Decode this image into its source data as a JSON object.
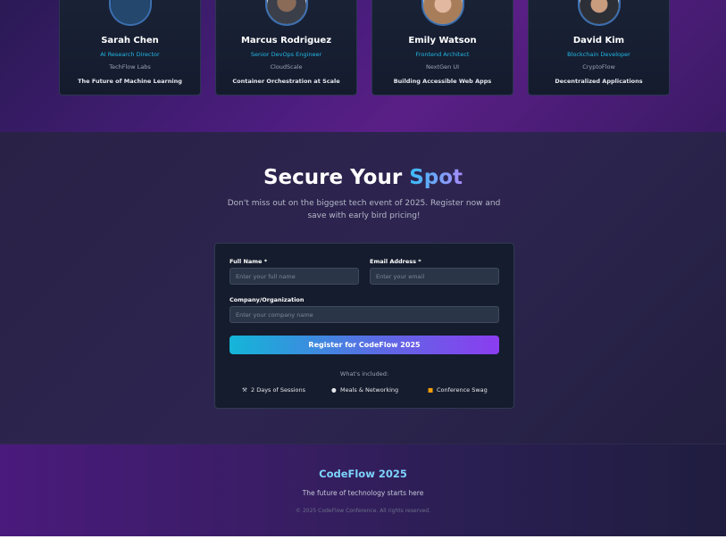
{
  "speakers": [
    {
      "name": "Sarah Chen",
      "role": "AI Research Director",
      "company": "TechFlow Labs",
      "talk": "The Future of Machine Learning"
    },
    {
      "name": "Marcus Rodriguez",
      "role": "Senior DevOps Engineer",
      "company": "CloudScale",
      "talk": "Container Orchestration at Scale"
    },
    {
      "name": "Emily Watson",
      "role": "Frontend Architect",
      "company": "NextGen UI",
      "talk": "Building Accessible Web Apps"
    },
    {
      "name": "David Kim",
      "role": "Blockchain Developer",
      "company": "CryptoFlow",
      "talk": "Decentralized Applications"
    }
  ],
  "register": {
    "title_main": "Secure Your ",
    "title_accent": "Spot",
    "subtitle": "Don't miss out on the biggest tech event of 2025. Register now and save with early bird pricing!",
    "full_name_label": "Full Name *",
    "full_name_placeholder": "Enter your full name",
    "full_name_value": "",
    "email_label": "Email Address *",
    "email_placeholder": "Enter your email",
    "email_value": "",
    "company_label": "Company/Organization",
    "company_placeholder": "Enter your company name",
    "company_value": "",
    "submit_label": "Register for CodeFlow 2025",
    "included_title": "What's included:",
    "perks": [
      {
        "icon": "hammer-icon",
        "label": "2 Days of Sessions"
      },
      {
        "icon": "plate-icon",
        "label": "Meals & Networking"
      },
      {
        "icon": "gift-icon",
        "label": "Conference Swag"
      }
    ]
  },
  "footer": {
    "brand": "CodeFlow 2025",
    "tagline": "The future of technology starts here",
    "copyright": "© 2025 CodeFlow Conference. All rights reserved."
  },
  "colors": {
    "accent_cyan": "#22b8e6",
    "accent_purple": "#8b3df0",
    "card_bg": "#151c2d"
  }
}
